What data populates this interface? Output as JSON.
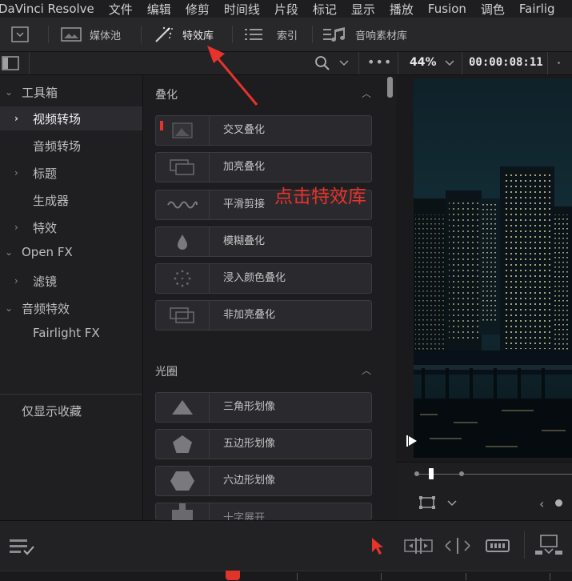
{
  "menu": [
    "DaVinci Resolve",
    "文件",
    "编辑",
    "修剪",
    "时间线",
    "片段",
    "标记",
    "显示",
    "播放",
    "Fusion",
    "调色",
    "Fairlig"
  ],
  "toolbar": {
    "media_pool": "媒体池",
    "effects_library": "特效库",
    "index": "索引",
    "sound_library": "音响素材库"
  },
  "viewer": {
    "zoom": "44%",
    "timecode": "00:00:08:11"
  },
  "sidebar": {
    "toolbox": "工具箱",
    "video_transitions": "视频转场",
    "audio_transitions": "音频转场",
    "titles": "标题",
    "generators": "生成器",
    "effects": "特效",
    "open_fx": "Open FX",
    "filters": "滤镜",
    "audio_fx": "音频特效",
    "fairlight_fx": "Fairlight FX",
    "favorites_only": "仅显示收藏"
  },
  "sections": {
    "dissolve": {
      "title": "叠化",
      "items": [
        "交叉叠化",
        "加亮叠化",
        "平滑剪接",
        "模糊叠化",
        "浸入颜色叠化",
        "非加亮叠化"
      ]
    },
    "iris": {
      "title": "光圈",
      "items": [
        "三角形划像",
        "五边形划像",
        "六边形划像",
        "十字展开"
      ]
    }
  },
  "annotation": {
    "text": "点击特效库",
    "color": "#e8322c"
  },
  "colors": {
    "accent_red": "#e8322c",
    "playhead": "#e0342a"
  }
}
